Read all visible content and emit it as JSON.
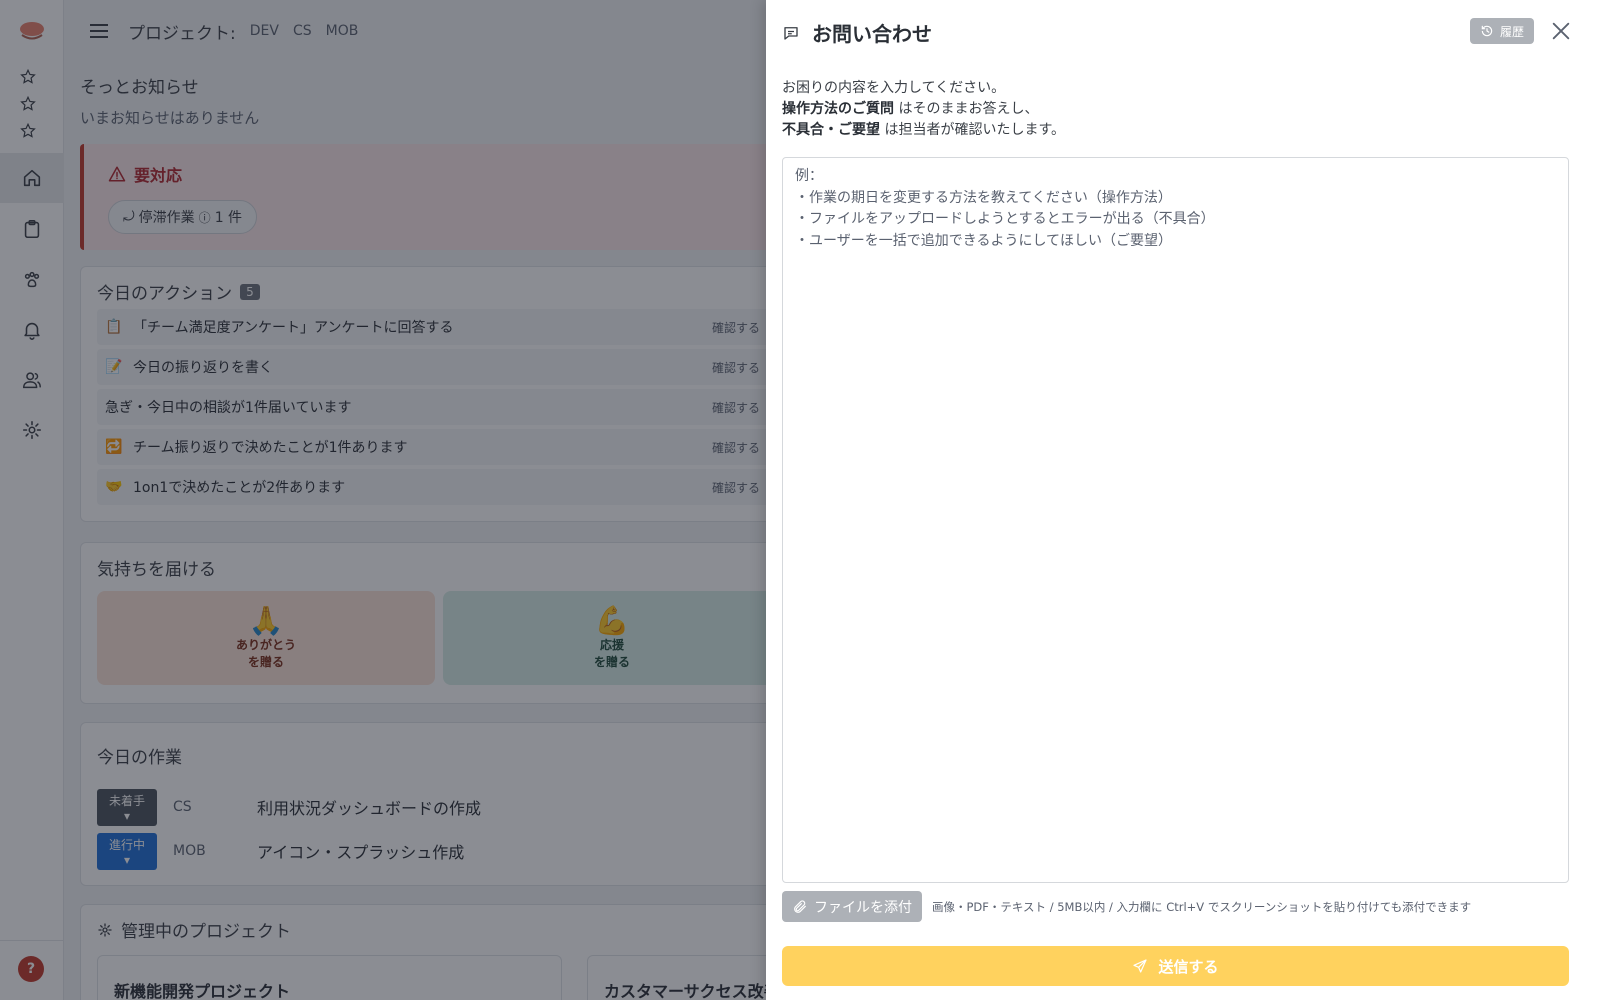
{
  "header": {
    "project_label": "プロジェクト:",
    "projects": [
      "DEV",
      "CS",
      "MOB"
    ]
  },
  "notice": {
    "title": "そっとお知らせ",
    "empty": "いまお知らせはありません"
  },
  "alert": {
    "title": "要対応",
    "chip_label": "停滞作業",
    "chip_count": "1 件"
  },
  "actions": {
    "title": "今日のアクション",
    "count": "5",
    "confirm_label": "確認する",
    "items": [
      {
        "emoji": "📋",
        "text": "「チーム満足度アンケート」アンケートに回答する"
      },
      {
        "emoji": "📝",
        "text": "今日の振り返りを書く"
      },
      {
        "emoji": "",
        "text": "急ぎ・今日中の相談が1件届いています"
      },
      {
        "emoji": "🔁",
        "text": "チーム振り返りで決めたことが1件あります"
      },
      {
        "emoji": "🤝",
        "text": "1on1で決めたことが2件あります"
      }
    ]
  },
  "feelings": {
    "title": "気持ちを届ける",
    "items": [
      {
        "emoji": "🙏",
        "line1": "ありがとう",
        "line2": "を贈る"
      },
      {
        "emoji": "💪",
        "line1": "応援",
        "line2": "を贈る"
      }
    ]
  },
  "tasks": {
    "title": "今日の作業",
    "items": [
      {
        "status": "未着手",
        "project": "CS",
        "name": "利用状況ダッシュボードの作成"
      },
      {
        "status": "進行中",
        "project": "MOB",
        "name": "アイコン・スプラッシュ作成"
      }
    ]
  },
  "managed": {
    "title": "管理中のプロジェクト",
    "items": [
      "新機能開発プロジェクト",
      "カスタマーサクセス改善"
    ]
  },
  "drawer": {
    "title": "お問い合わせ",
    "history_label": "履歴",
    "intro_line1": "お困りの内容を入力してください。",
    "intro_bold2": "操作方法のご質問",
    "intro_rest2": " はそのままお答えし、",
    "intro_bold3": "不具合・ご要望",
    "intro_rest3": " は担当者が確認いたします。",
    "placeholder": "例：\n・作業の期日を変更する方法を教えてください（操作方法）\n・ファイルをアップロードしようとするとエラーが出る（不具合）\n・ユーザーを一括で追加できるようにしてほしい（ご要望）",
    "attach_label": "ファイルを添付",
    "attach_note": "画像・PDF・テキスト / 5MB以内 / 入力欄に Ctrl+V でスクリーンショットを貼り付けても添付できます",
    "send_label": "送信する"
  },
  "help_label": "?",
  "colors": {
    "alert_red": "#c0392b",
    "status_todo": "#4a525c",
    "status_doing": "#1f6fd6",
    "send_button": "#ffd25e",
    "overlay": "rgba(23,28,40,0.5)"
  }
}
